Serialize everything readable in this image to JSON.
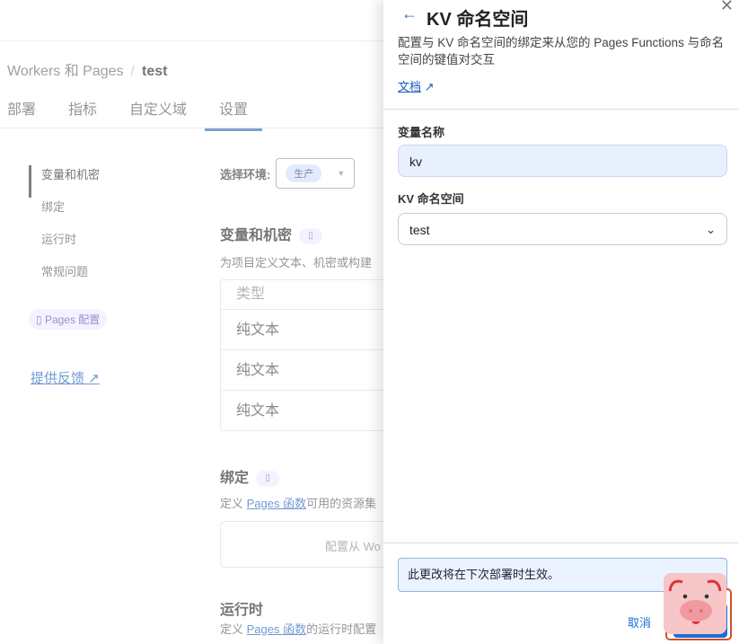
{
  "breadcrumb": {
    "parent": "Workers 和 Pages",
    "separator": "/",
    "current": "test"
  },
  "tabs": [
    "部署",
    "指标",
    "自定义域",
    "设置"
  ],
  "sidebar": {
    "items": [
      "变量和机密",
      "绑定",
      "运行时",
      "常规问题"
    ],
    "pages_config": "Pages 配置",
    "feedback": "提供反馈"
  },
  "main": {
    "env_label": "选择环境:",
    "env_value": "生产",
    "vars": {
      "title": "变量和机密",
      "desc": "为项目定义文本、机密或构建",
      "col_type": "类型",
      "rows": [
        "纯文本",
        "纯文本",
        "纯文本"
      ]
    },
    "bindings": {
      "title": "绑定",
      "desc_pre": "定义 ",
      "link": "Pages 函数",
      "desc_post": "可用的资源集",
      "empty": "配置从 Wo"
    },
    "runtime": {
      "title": "运行时",
      "desc_pre": "定义 ",
      "link": "Pages 函数",
      "desc_post": "的运行时配置"
    }
  },
  "panel": {
    "title": "KV 命名空间",
    "desc": "配置与 KV 命名空间的绑定来从您的 Pages Functions 与命名空间的键值对交互",
    "docs": "文档",
    "var_label": "变量名称",
    "var_value": "kv",
    "ns_label": "KV 命名空间",
    "ns_value": "test",
    "notice": "此更改将在下次部署时生效。",
    "cancel": "取消"
  },
  "colors": {
    "accent": "#1a6fd8",
    "link": "#1a5bb8"
  }
}
